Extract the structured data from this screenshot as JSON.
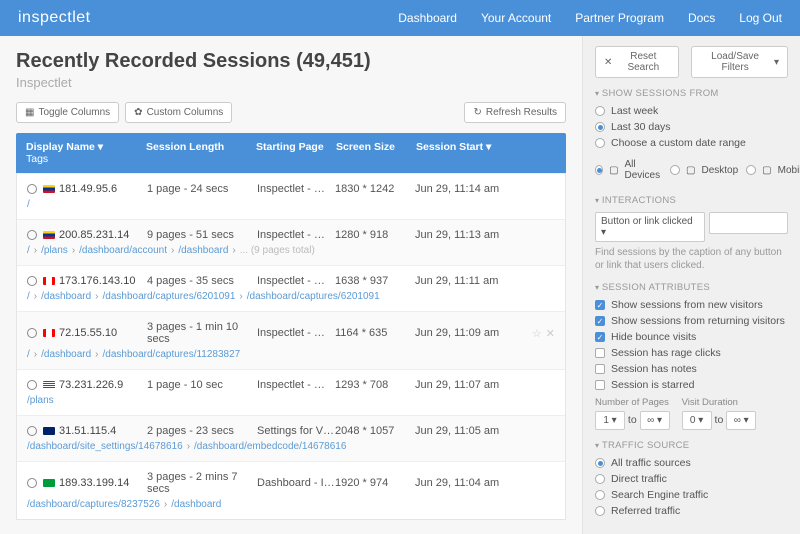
{
  "nav": {
    "brand": "inspectlet",
    "items": [
      "Dashboard",
      "Your Account",
      "Partner Program",
      "Docs",
      "Log Out"
    ]
  },
  "header": {
    "title": "Recently Recorded Sessions (49,451)",
    "subtitle": "Inspectlet"
  },
  "toolbar": {
    "toggle": "Toggle Columns",
    "custom": "Custom Columns",
    "refresh": "Refresh Results"
  },
  "cols": {
    "name": "Display Name",
    "tags": "Tags",
    "len": "Session Length",
    "start": "Starting Page",
    "size": "Screen Size",
    "date": "Session Start"
  },
  "rows": [
    {
      "flag": "co",
      "ip": "181.49.95.6",
      "len": "1 page - 24 secs",
      "start": "Inspectlet - Website Heatm...",
      "size": "1830 * 1242",
      "date": "Jun 29, 11:14 am",
      "paths": [
        "/"
      ]
    },
    {
      "flag": "co",
      "ip": "200.85.231.14",
      "len": "9 pages - 51 secs",
      "start": "Inspectlet - Website Heatm...",
      "size": "1280 * 918",
      "date": "Jun 29, 11:13 am",
      "paths": [
        "/",
        "/plans",
        "/dashboard/account",
        "/dashboard"
      ],
      "more": "... (9 pages total)"
    },
    {
      "flag": "ca",
      "ip": "173.176.143.10",
      "len": "4 pages - 35 secs",
      "start": "Inspectlet - Website Heatm...",
      "size": "1638 * 937",
      "date": "Jun 29, 11:11 am",
      "paths": [
        "/",
        "/dashboard",
        "/dashboard/captures/6201091",
        "/dashboard/captures/6201091"
      ]
    },
    {
      "flag": "ca",
      "ip": "72.15.55.10",
      "len": "3 pages - 1 min 10 secs",
      "start": "Inspectlet - Website Heatm...",
      "size": "1164 * 635",
      "date": "Jun 29, 11:09 am",
      "paths": [
        "/",
        "/dashboard",
        "/dashboard/captures/11283827"
      ],
      "starred": true
    },
    {
      "flag": "us",
      "ip": "73.231.226.9",
      "len": "1 page - 10 sec",
      "start": "Inspectlet - Website Heatm...",
      "size": "1293 * 708",
      "date": "Jun 29, 11:07 am",
      "paths": [
        "/plans"
      ]
    },
    {
      "flag": "gb",
      "ip": "31.51.115.4",
      "len": "2 pages - 23 secs",
      "start": "Settings for VbyPalm - Insp...",
      "size": "2048 * 1057",
      "date": "Jun 29, 11:05 am",
      "paths": [
        "/dashboard/site_settings/14678616",
        "/dashboard/embedcode/14678616"
      ]
    },
    {
      "flag": "br",
      "ip": "189.33.199.14",
      "len": "3 pages - 2 mins 7 secs",
      "start": "Dashboard - Inspectlet",
      "size": "1920 * 974",
      "date": "Jun 29, 11:04 am",
      "paths": [
        "/dashboard/captures/8237526",
        "/dashboard"
      ]
    }
  ],
  "side": {
    "reset": "Reset Search",
    "loadsave": "Load/Save Filters",
    "s1": "SHOW SESSIONS FROM",
    "time": [
      {
        "l": "Last week",
        "on": false
      },
      {
        "l": "Last 30 days",
        "on": true
      },
      {
        "l": "Choose a custom date range",
        "on": false
      }
    ],
    "dev": [
      {
        "l": "All Devices",
        "on": true
      },
      {
        "l": "Desktop",
        "on": false
      },
      {
        "l": "Mobile",
        "on": false
      }
    ],
    "s2": "INTERACTIONS",
    "intSel": "Button or link clicked",
    "intHelp": "Find sessions by the caption of any button or link that users clicked.",
    "s3": "SESSION ATTRIBUTES",
    "attrs": [
      {
        "l": "Show sessions from new visitors",
        "on": true
      },
      {
        "l": "Show sessions from returning visitors",
        "on": true
      },
      {
        "l": "Hide bounce visits",
        "on": true
      },
      {
        "l": "Session has rage clicks",
        "on": false
      },
      {
        "l": "Session has notes",
        "on": false
      },
      {
        "l": "Session is starred",
        "on": false
      }
    ],
    "pagesLabel": "Number of Pages",
    "durLabel": "Visit Duration",
    "pagesFrom": "1",
    "to": "to",
    "inf": "∞",
    "durFrom": "0",
    "s4": "TRAFFIC SOURCE",
    "traffic": [
      {
        "l": "All traffic sources",
        "on": true
      },
      {
        "l": "Direct traffic",
        "on": false
      },
      {
        "l": "Search Engine traffic",
        "on": false
      },
      {
        "l": "Referred traffic",
        "on": false
      }
    ]
  }
}
